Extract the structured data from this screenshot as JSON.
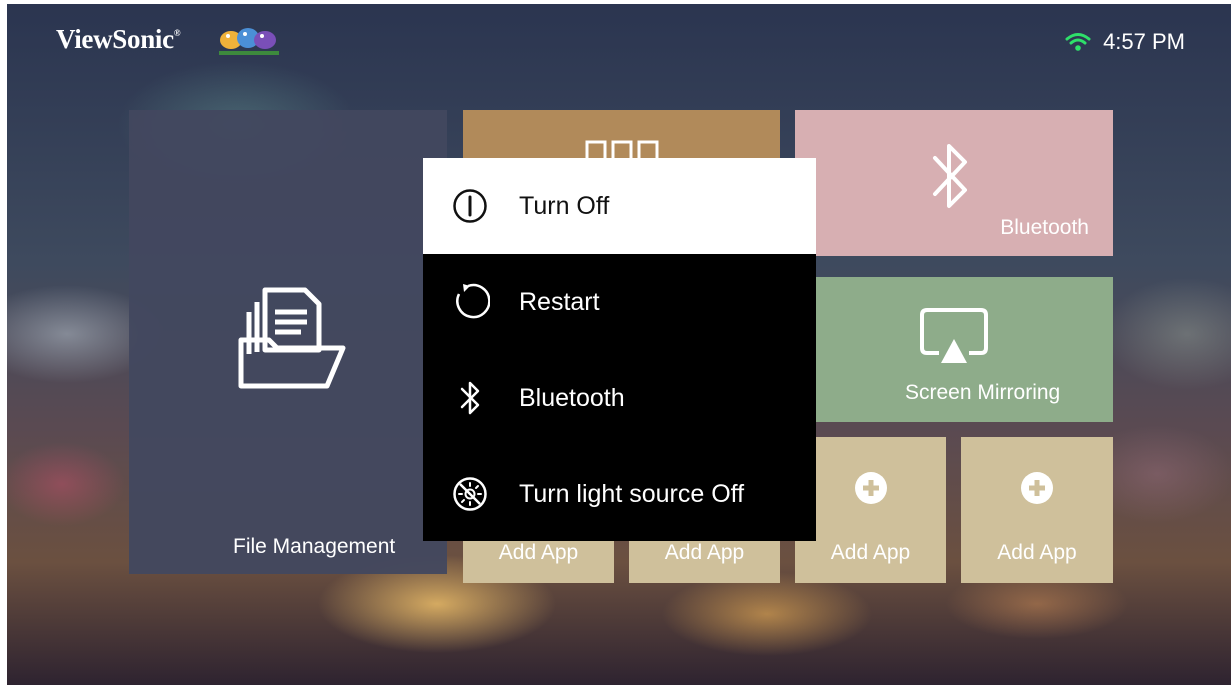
{
  "header": {
    "brand": "ViewSonic",
    "brand_mark": "®",
    "time": "4:57 PM",
    "wifi_icon": "wifi-icon"
  },
  "tiles": {
    "file_management": "File Management",
    "bluetooth": "Bluetooth",
    "screen_mirroring": "Screen Mirroring",
    "add_apps": [
      "Add App",
      "Add App",
      "Add App",
      "Add App"
    ]
  },
  "power_menu": {
    "items": [
      {
        "label": "Turn Off",
        "icon": "power-icon",
        "selected": true
      },
      {
        "label": "Restart",
        "icon": "restart-icon",
        "selected": false
      },
      {
        "label": "Bluetooth",
        "icon": "bluetooth-icon",
        "selected": false
      },
      {
        "label": "Turn light source Off",
        "icon": "light-off-icon",
        "selected": false
      }
    ]
  },
  "colors": {
    "file_tile": "#42485f",
    "apps_tile": "#b18a5a",
    "bluetooth_tile": "#d7afb2",
    "mirroring_tile": "#8eac8a",
    "add_app_tile": "#cfc09b",
    "menu_bg": "#000000",
    "menu_selected_bg": "#ffffff"
  }
}
